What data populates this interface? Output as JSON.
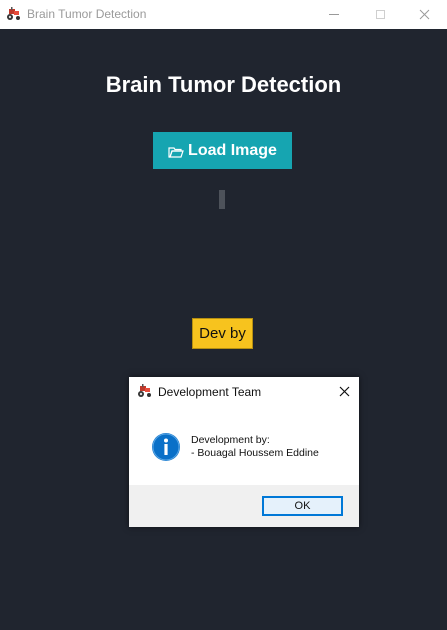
{
  "window": {
    "title": "Brain Tumor Detection"
  },
  "main": {
    "heading": "Brain Tumor Detection",
    "load_button_label": "Load Image",
    "dev_button_label": "Dev by"
  },
  "dialog": {
    "title": "Development Team",
    "message_line1": "Development by:",
    "message_line2": "- Bouagal Houssem Eddine",
    "ok_label": "OK"
  },
  "colors": {
    "background": "#20252f",
    "load_button": "#16a5b1",
    "dev_button": "#f7c31e",
    "info_icon": "#0a70c8",
    "ok_focus": "#0078d7"
  },
  "icons": {
    "app": "tractor-icon",
    "load": "folder-open-icon",
    "dialog_info": "info-icon",
    "close": "close-icon"
  }
}
